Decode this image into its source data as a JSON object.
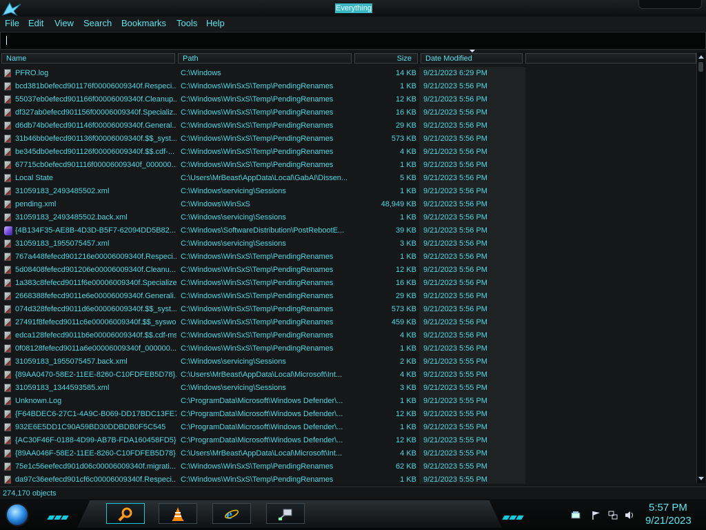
{
  "window": {
    "title": "Everything"
  },
  "menu": [
    "File",
    "Edit",
    "View",
    "Search",
    "Bookmarks",
    "Tools",
    "Help"
  ],
  "search": {
    "value": ""
  },
  "columns": {
    "name": "Name",
    "path": "Path",
    "size": "Size",
    "date": "Date Modified"
  },
  "rows": [
    {
      "icon": "file",
      "name": "PFRO.log",
      "path": "C:\\Windows",
      "size": "14 KB",
      "date": "9/21/2023 6:29 PM"
    },
    {
      "icon": "file",
      "name": "bcd381b0efecd901176f00006009340f.Respeci...",
      "path": "C:\\Windows\\WinSxS\\Temp\\PendingRenames",
      "size": "1 KB",
      "date": "9/21/2023 5:56 PM"
    },
    {
      "icon": "file",
      "name": "55037eb0efecd901166f00006009340f.Cleanup...",
      "path": "C:\\Windows\\WinSxS\\Temp\\PendingRenames",
      "size": "12 KB",
      "date": "9/21/2023 5:56 PM"
    },
    {
      "icon": "file",
      "name": "df327ab0efecd901156f00006009340f.Specializ...",
      "path": "C:\\Windows\\WinSxS\\Temp\\PendingRenames",
      "size": "16 KB",
      "date": "9/21/2023 5:56 PM"
    },
    {
      "icon": "file",
      "name": "d6db74b0efecd901146f00006009340f.General...",
      "path": "C:\\Windows\\WinSxS\\Temp\\PendingRenames",
      "size": "29 KB",
      "date": "9/21/2023 5:56 PM"
    },
    {
      "icon": "file",
      "name": "31b46bb0efecd901136f00006009340f.$$_syst...",
      "path": "C:\\Windows\\WinSxS\\Temp\\PendingRenames",
      "size": "573 KB",
      "date": "9/21/2023 5:56 PM"
    },
    {
      "icon": "file",
      "name": "be345db0efecd901126f00006009340f.$$.cdf-...",
      "path": "C:\\Windows\\WinSxS\\Temp\\PendingRenames",
      "size": "4 KB",
      "date": "9/21/2023 5:56 PM"
    },
    {
      "icon": "file",
      "name": "67715cb0efecd901116f00006009340f_000000...",
      "path": "C:\\Windows\\WinSxS\\Temp\\PendingRenames",
      "size": "1 KB",
      "date": "9/21/2023 5:56 PM"
    },
    {
      "icon": "file",
      "name": "Local State",
      "path": "C:\\Users\\MrBeast\\AppData\\Local\\GabAI\\Dissen...",
      "size": "5 KB",
      "date": "9/21/2023 5:56 PM"
    },
    {
      "icon": "file",
      "name": "31059183_2493485502.xml",
      "path": "C:\\Windows\\servicing\\Sessions",
      "size": "1 KB",
      "date": "9/21/2023 5:56 PM"
    },
    {
      "icon": "file",
      "name": "pending.xml",
      "path": "C:\\Windows\\WinSxS",
      "size": "48,949 KB",
      "date": "9/21/2023 5:56 PM"
    },
    {
      "icon": "file",
      "name": "31059183_2493485502.back.xml",
      "path": "C:\\Windows\\servicing\\Sessions",
      "size": "1 KB",
      "date": "9/21/2023 5:56 PM"
    },
    {
      "icon": "gem",
      "name": "{4B134F35-AE8B-4D3D-B5F7-62094DD5B82...",
      "path": "C:\\Windows\\SoftwareDistribution\\PostRebootE...",
      "size": "39 KB",
      "date": "9/21/2023 5:56 PM"
    },
    {
      "icon": "file",
      "name": "31059183_1955075457.xml",
      "path": "C:\\Windows\\servicing\\Sessions",
      "size": "3 KB",
      "date": "9/21/2023 5:56 PM"
    },
    {
      "icon": "file",
      "name": "767a448fefecd901216e00006009340f.Respeci...",
      "path": "C:\\Windows\\WinSxS\\Temp\\PendingRenames",
      "size": "1 KB",
      "date": "9/21/2023 5:56 PM"
    },
    {
      "icon": "file",
      "name": "5d08408fefecd901206e00006009340f.Cleanu...",
      "path": "C:\\Windows\\WinSxS\\Temp\\PendingRenames",
      "size": "12 KB",
      "date": "9/21/2023 5:56 PM"
    },
    {
      "icon": "file",
      "name": "1a383c8fefecd9011f6e00006009340f.Specialize...",
      "path": "C:\\Windows\\WinSxS\\Temp\\PendingRenames",
      "size": "16 KB",
      "date": "9/21/2023 5:56 PM"
    },
    {
      "icon": "file",
      "name": "2668388fefecd9011e6e00006009340f.Generali...",
      "path": "C:\\Windows\\WinSxS\\Temp\\PendingRenames",
      "size": "29 KB",
      "date": "9/21/2023 5:56 PM"
    },
    {
      "icon": "file",
      "name": "074d328fefecd9011d6e00006009340f.$$_syst...",
      "path": "C:\\Windows\\WinSxS\\Temp\\PendingRenames",
      "size": "573 KB",
      "date": "9/21/2023 5:56 PM"
    },
    {
      "icon": "file",
      "name": "27491f8fefecd9011c6e00006009340f.$$_syswo...",
      "path": "C:\\Windows\\WinSxS\\Temp\\PendingRenames",
      "size": "459 KB",
      "date": "9/21/2023 5:56 PM"
    },
    {
      "icon": "file",
      "name": "edca128fefecd9011b6e00006009340f.$$.cdf-ms",
      "path": "C:\\Windows\\WinSxS\\Temp\\PendingRenames",
      "size": "4 KB",
      "date": "9/21/2023 5:56 PM"
    },
    {
      "icon": "file",
      "name": "0f08128fefecd9011a6e00006009340f_000000...",
      "path": "C:\\Windows\\WinSxS\\Temp\\PendingRenames",
      "size": "1 KB",
      "date": "9/21/2023 5:56 PM"
    },
    {
      "icon": "file",
      "name": "31059183_1955075457.back.xml",
      "path": "C:\\Windows\\servicing\\Sessions",
      "size": "2 KB",
      "date": "9/21/2023 5:55 PM"
    },
    {
      "icon": "file",
      "name": "{89AA0470-58E2-11EE-8260-C10FDFEB5D78}...",
      "path": "C:\\Users\\MrBeast\\AppData\\Local\\Microsoft\\Int...",
      "size": "4 KB",
      "date": "9/21/2023 5:55 PM"
    },
    {
      "icon": "file",
      "name": "31059183_1344593585.xml",
      "path": "C:\\Windows\\servicing\\Sessions",
      "size": "3 KB",
      "date": "9/21/2023 5:55 PM"
    },
    {
      "icon": "file",
      "name": "Unknown.Log",
      "path": "C:\\ProgramData\\Microsoft\\Windows Defender\\...",
      "size": "1 KB",
      "date": "9/21/2023 5:55 PM"
    },
    {
      "icon": "file",
      "name": "{F64BDEC6-27C1-4A9C-B069-DD17BDC13FE7}",
      "path": "C:\\ProgramData\\Microsoft\\Windows Defender\\...",
      "size": "12 KB",
      "date": "9/21/2023 5:55 PM"
    },
    {
      "icon": "file",
      "name": "932E6E5DD1C90A59BD30DDBDB0F5C545",
      "path": "C:\\ProgramData\\Microsoft\\Windows Defender\\...",
      "size": "1 KB",
      "date": "9/21/2023 5:55 PM"
    },
    {
      "icon": "file",
      "name": "{AC30F46F-0188-4D99-AB7B-FDA160458FD5}",
      "path": "C:\\ProgramData\\Microsoft\\Windows Defender\\...",
      "size": "12 KB",
      "date": "9/21/2023 5:55 PM"
    },
    {
      "icon": "file",
      "name": "{89AA046F-58E2-11EE-8260-C10FDFEB5D78}...",
      "path": "C:\\Users\\MrBeast\\AppData\\Local\\Microsoft\\Int...",
      "size": "4 KB",
      "date": "9/21/2023 5:55 PM"
    },
    {
      "icon": "file",
      "name": "75e1c56eefecd901d06c00006009340f.migrati...",
      "path": "C:\\Windows\\WinSxS\\Temp\\PendingRenames",
      "size": "62 KB",
      "date": "9/21/2023 5:55 PM"
    },
    {
      "icon": "file",
      "name": "da97c36eefecd901cf6c00006009340f.Respeci...",
      "path": "C:\\Windows\\WinSxS\\Temp\\PendingRenames",
      "size": "1 KB",
      "date": "9/21/2023 5:55 PM"
    }
  ],
  "status": {
    "text": "274,170 objects"
  },
  "taskbar": {
    "apps": [
      {
        "icon": "search-magnifier-icon",
        "active": true
      },
      {
        "icon": "vlc-cone-icon",
        "active": false
      },
      {
        "icon": "internet-explorer-icon",
        "active": false
      },
      {
        "icon": "network-computer-icon",
        "active": false
      }
    ],
    "tray_icons": [
      "network-drive-icon",
      "action-center-flag-icon",
      "network-icon",
      "volume-icon"
    ],
    "clock": {
      "time": "5:57 PM",
      "date": "9/21/2023"
    }
  },
  "colors": {
    "accent": "#4fd9e4",
    "background": "#151718",
    "date_column_bg": "#1f2223",
    "title_highlight": "#3bb7c4"
  }
}
